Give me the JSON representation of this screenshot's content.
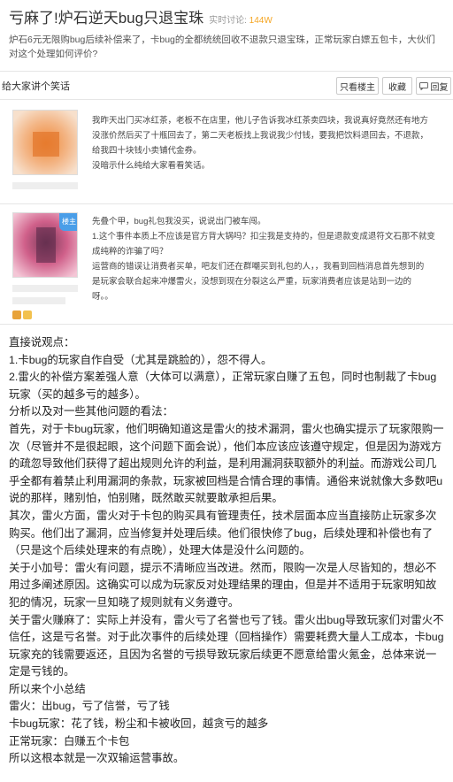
{
  "thread": {
    "title": "亏麻了!炉石逆天bug只退宝珠",
    "meta_label": "实时讨论:",
    "meta_count": "144W",
    "description": "炉石6元无限购bug后续补偿来了，卡bug的全都统统回收不退款只退宝珠，正常玩家白嫖五包卡，大伙们对这个处理如何评价?"
  },
  "first_post": {
    "title": "给大家讲个笑话",
    "buttons": {
      "only_lz": "只看楼主",
      "favorite": "收藏",
      "reply": "回复"
    }
  },
  "post1": {
    "lines": [
      "我昨天出门买冰红茶，老板不在店里，他儿子告诉我冰红茶卖四块，我说真好竟然还有地方",
      "没涨价然后买了十瓶回去了，第二天老板找上我说我少付钱，要我把饮料退回去，不退款，",
      "给我四十块钱小卖铺代金券。",
      "没暗示什么纯给大家看看笑话。"
    ]
  },
  "post2": {
    "lz_tag": "楼主",
    "lines": [
      "先叠个甲，bug礼包我没买，说说出门被车闯。",
      "1.这个事件本质上不应该是官方背大锅吗？扣尘我是支持的，但是退款变成退符文石那不就变",
      "成纯粹的诈骗了吗？",
      "运营商的错误让消费者买单，吧友们还在群嘲买到礼包的人，，我看到回档消息首先想到的",
      "是玩家会联合起来冲爆雷火，没想到现在分裂这么严重，玩家消费者应该是站到一边的",
      "呀。。"
    ]
  },
  "main_paragraphs": [
    "直接说观点：",
    "1.卡bug的玩家自作自受（尤其是跳脸的），怨不得人。",
    "2.雷火的补偿方案差强人意（大体可以满意），正常玩家白赚了五包，同时也制裁了卡bug玩家（买的越多亏的越多）。",
    "分析以及对一些其他问题的看法：",
    "首先，对于卡bug玩家，他们明确知道这是雷火的技术漏洞，雷火也确实提示了玩家限购一次（尽管并不是很起眼，这个问题下面会说），他们本应该应该遵守规定，但是因为游戏方的疏忽导致他们获得了超出规则允许的利益，是利用漏洞获取额外的利益。而游戏公司几乎全都有着禁止利用漏洞的条款，玩家被回档是合情合理的事情。通俗来说就像大多数吧u说的那样，赌别怕，怕别赌，既然敢买就要敢承担后果。",
    "其次，雷火方面，雷火对于卡包的购买具有管理责任，技术层面本应当直接防止玩家多次购买。他们出了漏洞，应当修复并处理后续。他们很快修了bug，后续处理和补偿也有了（只是这个后续处理来的有点晚），处理大体是没什么问题的。",
    "关于小加号：雷火有问题，提示不清晰应当改进。然而，限购一次是人尽皆知的，想必不用过多阐述原因。这确实可以成为玩家反对处理结果的理由，但是并不适用于玩家明知故犯的情况，玩家一旦知晓了规则就有义务遵守。",
    "关于雷火赚麻了：实际上并没有，雷火亏了名誉也亏了钱。雷火出bug导致玩家们对雷火不信任，这是亏名誉。对于此次事件的后续处理（回档操作）需要耗费大量人工成本，卡bug玩家充的钱需要返还，且因为名誉的亏损导致玩家后续更不愿意给雷火氪金，总体来说一定是亏钱的。",
    "所以来个小总结",
    "雷火：出bug，亏了信誉，亏了钱",
    "卡bug玩家：花了钱，粉尘和卡被收回，越贪亏的越多",
    "正常玩家：白赚五个卡包",
    "所以这根本就是一次双输运营事故。"
  ]
}
